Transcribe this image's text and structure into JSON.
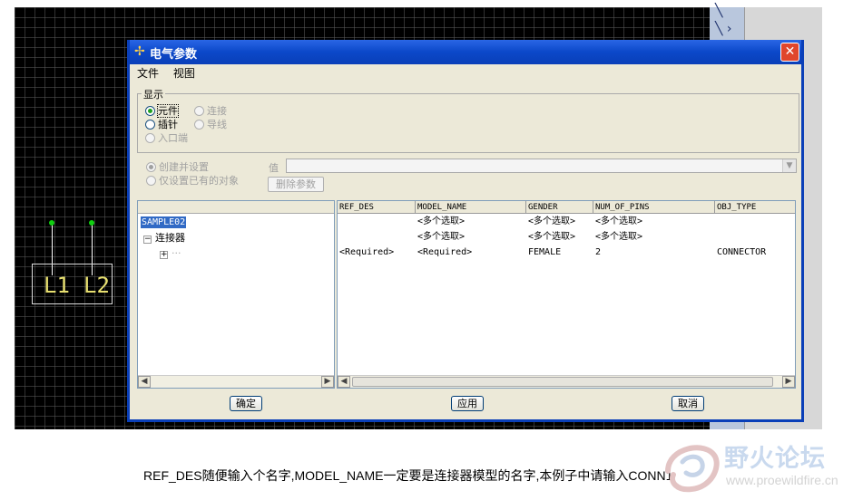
{
  "dialog": {
    "title": "电气参数",
    "close_glyph": "✕",
    "menu": [
      "文件",
      "视图"
    ],
    "display_group": {
      "legend": "显示",
      "options": {
        "component": "元件",
        "connection": "连接",
        "pin": "插针",
        "wire": "导线",
        "port": "入口端"
      },
      "selected": "component"
    },
    "mode": {
      "create_and_set": "创建并设置",
      "set_existing_only": "仅设置已有的对象",
      "selected": "create_and_set"
    },
    "value_label": "值",
    "value_input": "",
    "delete_param_button": "删除参数",
    "tree": {
      "root": "SAMPLE02",
      "child": "连接器",
      "grandchild_glyph": "+"
    },
    "table": {
      "columns": [
        "REF_DES",
        "MODEL_NAME",
        "GENDER",
        "NUM_OF_PINS",
        "OBJ_TYPE"
      ],
      "rows": [
        [
          "",
          "<多个选取>",
          "<多个选取>",
          "<多个选取>",
          ""
        ],
        [
          "",
          "<多个选取>",
          "<多个选取>",
          "<多个选取>",
          ""
        ],
        [
          "<Required>",
          "<Required>",
          "FEMALE",
          "2",
          "CONNECTOR"
        ]
      ]
    },
    "buttons": {
      "ok": "确定",
      "apply": "应用",
      "cancel": "取消"
    }
  },
  "schematic": {
    "pin_labels": [
      "L1",
      "L2"
    ]
  },
  "caption": "REF_DES随便输入个名字,MODEL_NAME一定要是连接器模型的名字,本例子中请输入CONN1",
  "watermark": {
    "title": "野火论坛",
    "url": "www.proewildfire.cn"
  },
  "colors": {
    "titlebar": "#0a3fb8",
    "selection": "#316ac5",
    "pin_node": "#10d010",
    "pin_text": "#e8e070"
  },
  "icons": [
    "dialog-app-icon",
    "close-icon",
    "scroll-left-icon",
    "scroll-right-icon",
    "combo-arrow-icon",
    "tree-expander-icon"
  ]
}
